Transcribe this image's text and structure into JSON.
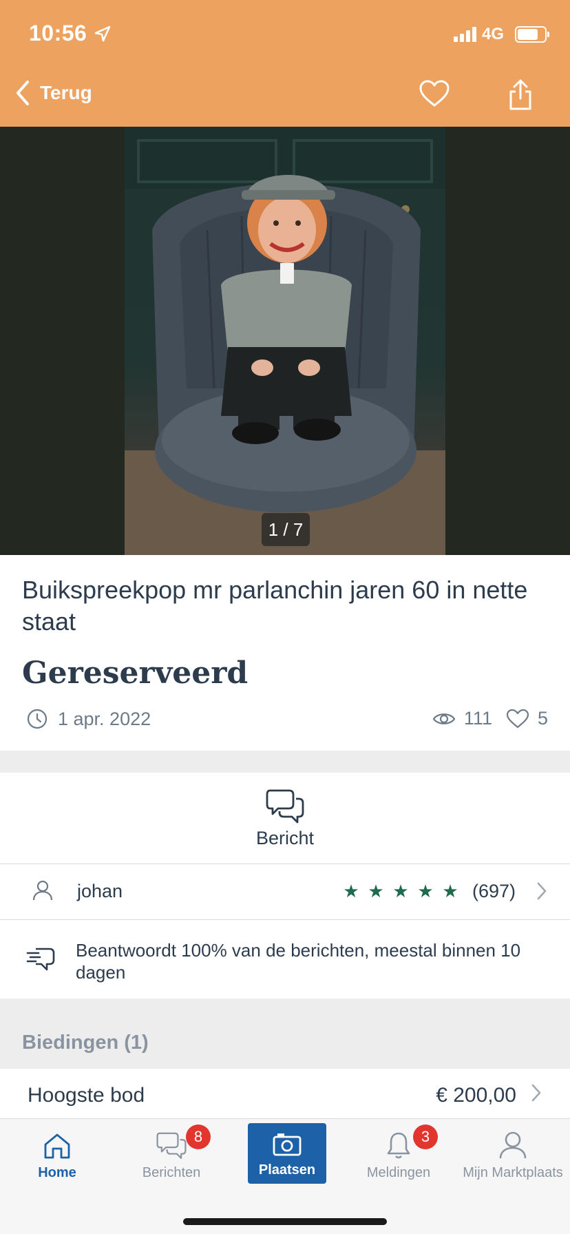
{
  "status_bar": {
    "time": "10:56",
    "network": "4G",
    "battery_level": 0.75
  },
  "nav": {
    "back_label": "Terug",
    "icons": [
      "heart-icon",
      "share-icon"
    ]
  },
  "gallery": {
    "counter": "1 / 7"
  },
  "listing": {
    "title": "Buikspreekpop mr parlanchin jaren 60 in nette staat",
    "status": "Gereserveerd",
    "date": "1 apr. 2022",
    "views": "111",
    "favorites": "5"
  },
  "contact": {
    "message_label": "Bericht",
    "seller_name": "johan",
    "rating_stars": 5,
    "rating_count": "(697)",
    "response_text": "Beantwoordt 100% van de berichten, meestal binnen 10 dagen"
  },
  "bids": {
    "section_title": "Biedingen (1)",
    "highest_label": "Hoogste bod",
    "highest_value": "€ 200,00"
  },
  "tabbar": {
    "home": "Home",
    "messages": "Berichten",
    "messages_badge": "8",
    "place": "Plaatsen",
    "notifications": "Meldingen",
    "notifications_badge": "3",
    "account": "Mijn Marktplaats"
  },
  "colors": {
    "header": "#eea260",
    "primary_blue": "#1d62a8",
    "star_green": "#1e6b4e",
    "badge_red": "#e2352e"
  }
}
